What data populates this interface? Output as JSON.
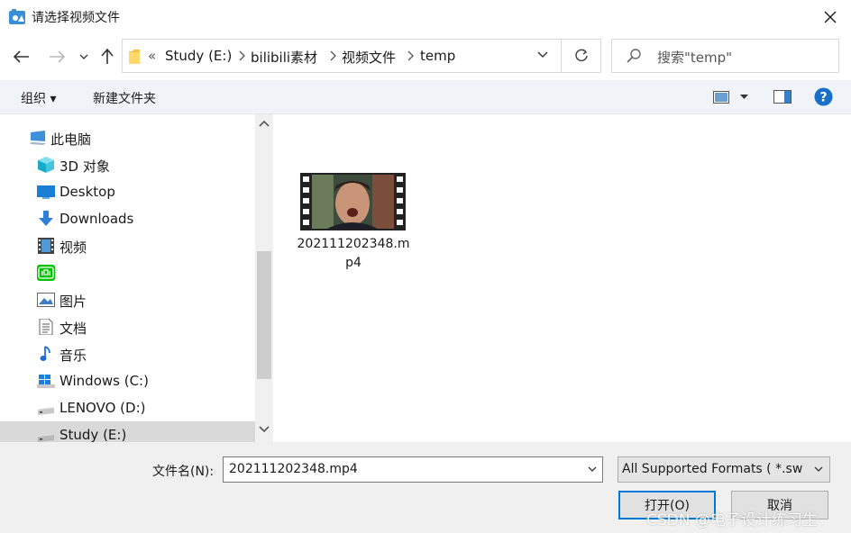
{
  "window": {
    "title": "请选择视频文件"
  },
  "address": {
    "segments": [
      "Study (E:)",
      "bilibili素材",
      "视频文件",
      "temp"
    ],
    "overflow": "«"
  },
  "search": {
    "placeholder": "搜索\"temp\""
  },
  "toolbar": {
    "organize": "组织 ▾",
    "new_folder": "新建文件夹"
  },
  "nav": {
    "items": [
      {
        "label": "此电脑",
        "icon": "computer-icon"
      },
      {
        "label": "3D 对象",
        "icon": "cube-icon"
      },
      {
        "label": "Desktop",
        "icon": "desktop-icon"
      },
      {
        "label": "Downloads",
        "icon": "download-icon"
      },
      {
        "label": "视频",
        "icon": "video-icon"
      },
      {
        "label": "",
        "icon": "iqiyi-icon"
      },
      {
        "label": "图片",
        "icon": "picture-icon"
      },
      {
        "label": "文档",
        "icon": "document-icon"
      },
      {
        "label": "音乐",
        "icon": "music-icon"
      },
      {
        "label": "Windows (C:)",
        "icon": "windows-drive-icon"
      },
      {
        "label": "LENOVO (D:)",
        "icon": "drive-icon"
      },
      {
        "label": "Study (E:)",
        "icon": "drive-icon"
      }
    ]
  },
  "files": [
    {
      "name": "202111202348.mp4",
      "icon": "video-thumbnail-icon"
    }
  ],
  "bottom": {
    "filename_label": "文件名(N):",
    "filename_value": "202111202348.mp4",
    "filetype_value": "All Supported Formats ( *.sw",
    "open_label": "打开(O)",
    "cancel_label": "取消"
  },
  "watermark": "CSDN @电子设计练习生",
  "colors": {
    "accent": "#0078d7",
    "toolbar_bg": "#f0f4f9",
    "selected_bg": "#d9d9d9"
  }
}
